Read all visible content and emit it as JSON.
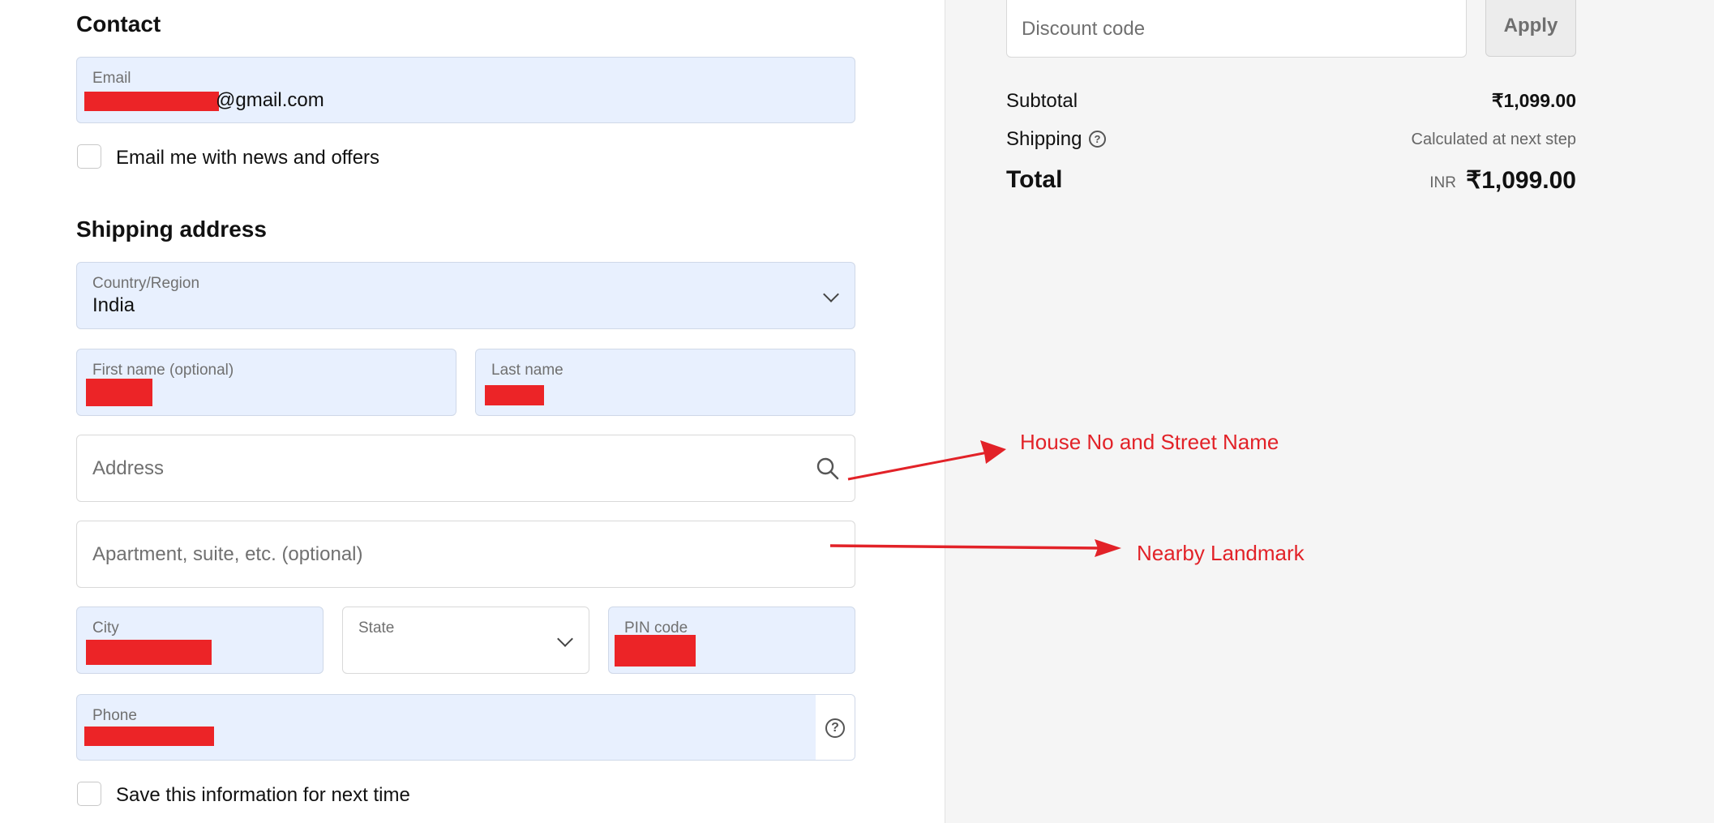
{
  "contact": {
    "heading": "Contact",
    "email_label": "Email",
    "email_suffix": "@gmail.com",
    "newsletter_label": "Email me with news and offers"
  },
  "shipping": {
    "heading": "Shipping address",
    "country_label": "Country/Region",
    "country_value": "India",
    "first_name_label": "First name (optional)",
    "last_name_label": "Last name",
    "address_placeholder": "Address",
    "apartment_placeholder": "Apartment, suite, etc. (optional)",
    "city_label": "City",
    "state_label": "State",
    "pin_label": "PIN code",
    "phone_label": "Phone",
    "save_info_label": "Save this information for next time"
  },
  "annotations": {
    "address_note": "House No and Street Name",
    "apartment_note": "Nearby Landmark",
    "color": "#e22228"
  },
  "summary": {
    "discount_placeholder": "Discount code",
    "apply_label": "Apply",
    "subtotal_label": "Subtotal",
    "subtotal_value": "₹1,099.00",
    "shipping_label": "Shipping",
    "shipping_value": "Calculated at next step",
    "total_label": "Total",
    "currency": "INR",
    "total_value": "₹1,099.00"
  }
}
